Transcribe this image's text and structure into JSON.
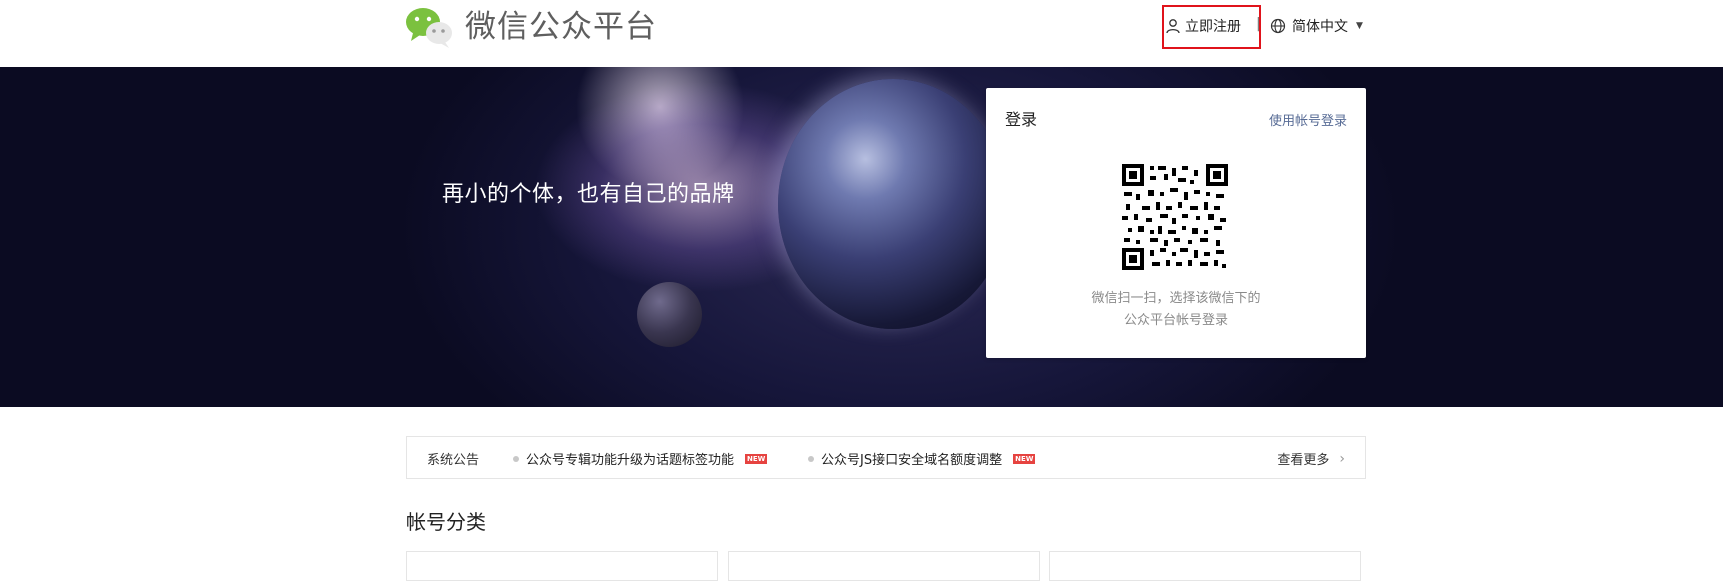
{
  "header": {
    "brand_title": "微信公众平台",
    "register_label": "立即注册",
    "separator": "|",
    "language_label": "简体中文",
    "highlight_color": "#e0131b"
  },
  "banner": {
    "slogan": "再小的个体，也有自己的品牌"
  },
  "login": {
    "title": "登录",
    "account_login_link": "使用帐号登录",
    "qr_hint_line1": "微信扫一扫，选择该微信下的",
    "qr_hint_line2": "公众平台帐号登录",
    "link_color": "#576b95"
  },
  "notice": {
    "label": "系统公告",
    "items": [
      {
        "text": "公众号专辑功能升级为话题标签功能",
        "badge": "NEW"
      },
      {
        "text": "公众号JS接口安全域名额度调整",
        "badge": "NEW"
      }
    ],
    "more_label": "查看更多",
    "badge_color": "#e64340"
  },
  "section": {
    "title": "帐号分类"
  },
  "icons": {
    "logo": "wechat-logo-icon",
    "user": "user-icon",
    "globe": "globe-icon",
    "caret": "caret-down-icon",
    "chevron": "chevron-right-icon",
    "qr": "qr-code-icon"
  }
}
